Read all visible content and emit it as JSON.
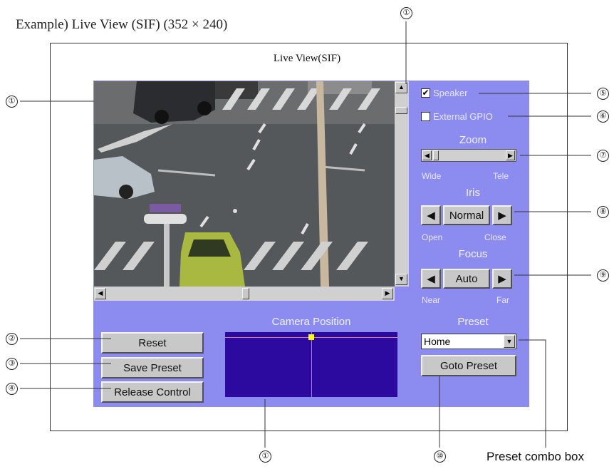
{
  "caption": "Example) Live View (SIF) (352 × 240)",
  "window_title": "Live View(SIF)",
  "controls": {
    "speaker_label": "Speaker",
    "speaker_checked": true,
    "gpio_label": "External GPIO",
    "gpio_checked": false,
    "zoom_title": "Zoom",
    "zoom_left": "Wide",
    "zoom_right": "Tele",
    "iris_title": "Iris",
    "iris_value": "Normal",
    "iris_left": "Open",
    "iris_right": "Close",
    "focus_title": "Focus",
    "focus_value": "Auto",
    "focus_left": "Near",
    "focus_right": "Far",
    "preset_title": "Preset",
    "preset_selected": "Home",
    "goto_label": "Goto Preset"
  },
  "bottom": {
    "reset_label": "Reset",
    "save_label": "Save Preset",
    "release_label": "Release Control",
    "camera_position_title": "Camera Position"
  },
  "callouts": {
    "c1": "①",
    "c2": "②",
    "c3": "③",
    "c4": "④",
    "c5": "⑤",
    "c6": "⑥",
    "c7": "⑦",
    "c8": "⑧",
    "c9": "⑨",
    "c10": "⑩"
  },
  "preset_combo_caption": "Preset combo box",
  "colors": {
    "panel": "#8c8cf0",
    "camera_position_bg": "#2c0aa0",
    "position_marker": "#ffff00",
    "crosshair": "#d08080"
  },
  "icons": [
    "checkbox-checked-icon",
    "checkbox-empty-icon",
    "scroll-arrow-left-icon",
    "scroll-arrow-right-icon",
    "scroll-arrow-up-icon",
    "scroll-arrow-down-icon",
    "triangle-left-icon",
    "triangle-right-icon",
    "dropdown-arrow-icon"
  ]
}
